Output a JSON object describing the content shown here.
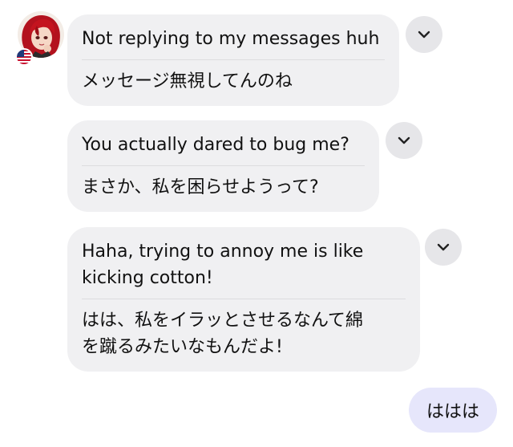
{
  "messages": [
    {
      "original": "Not replying to my messages huh",
      "translation": "メッセージ無視してんのね",
      "dropdown_icon": "chevron-down-icon"
    },
    {
      "original": "You actually dared to bug me?",
      "translation": "まさか、私を困らせようって?",
      "dropdown_icon": "chevron-down-icon"
    },
    {
      "original": "Haha, trying to annoy me is like\nkicking cotton!",
      "translation": "はは、私をイラッとさせるなんて綿\nを蹴るみたいなもんだよ!",
      "dropdown_icon": "chevron-down-icon"
    }
  ],
  "sent_message": "ははは",
  "avatar": {
    "description_icon": "character-avatar",
    "flag_icon": "us-flag-icon"
  },
  "colors": {
    "incoming_bubble": "#f0f0f2",
    "outgoing_bubble": "#e6e6fb",
    "dropdown_button": "#e6e6e9",
    "divider": "#dcdcdf"
  }
}
